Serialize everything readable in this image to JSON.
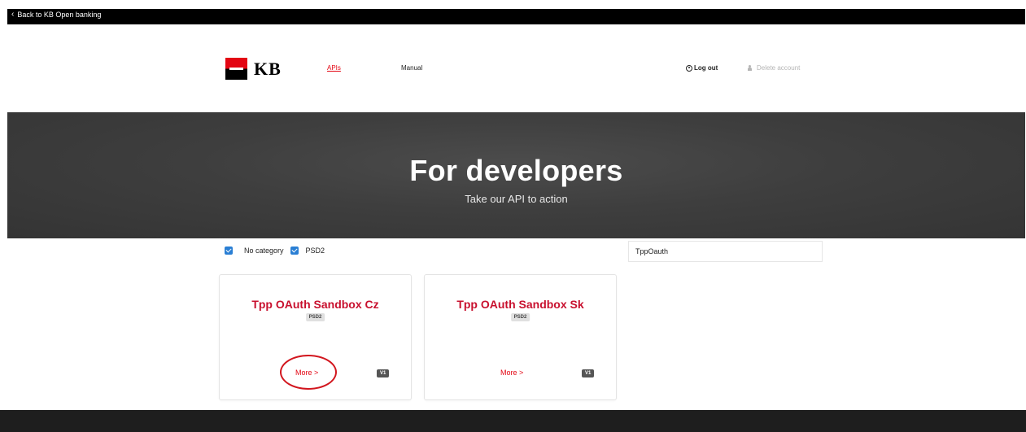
{
  "topbar": {
    "back_label": "Back to KB Open banking"
  },
  "header": {
    "logo_text": "KB",
    "nav": {
      "apis": "APIs",
      "manual": "Manual"
    },
    "logout": "Log out",
    "delete_account": "Delete account"
  },
  "hero": {
    "title": "For developers",
    "subtitle": "Take our API to action"
  },
  "filters": {
    "no_category": "No category",
    "psd2": "PSD2"
  },
  "search": {
    "value": "TppOauth"
  },
  "cards": [
    {
      "title": "Tpp OAuth Sandbox Cz",
      "badge": "PSD2",
      "more": "More >",
      "version": "V1"
    },
    {
      "title": "Tpp OAuth Sandbox Sk",
      "badge": "PSD2",
      "more": "More >",
      "version": "V1"
    }
  ],
  "colors": {
    "brand_red": "#e30613",
    "title_red": "#c8102e",
    "checkbox_blue": "#2a7fd4"
  }
}
